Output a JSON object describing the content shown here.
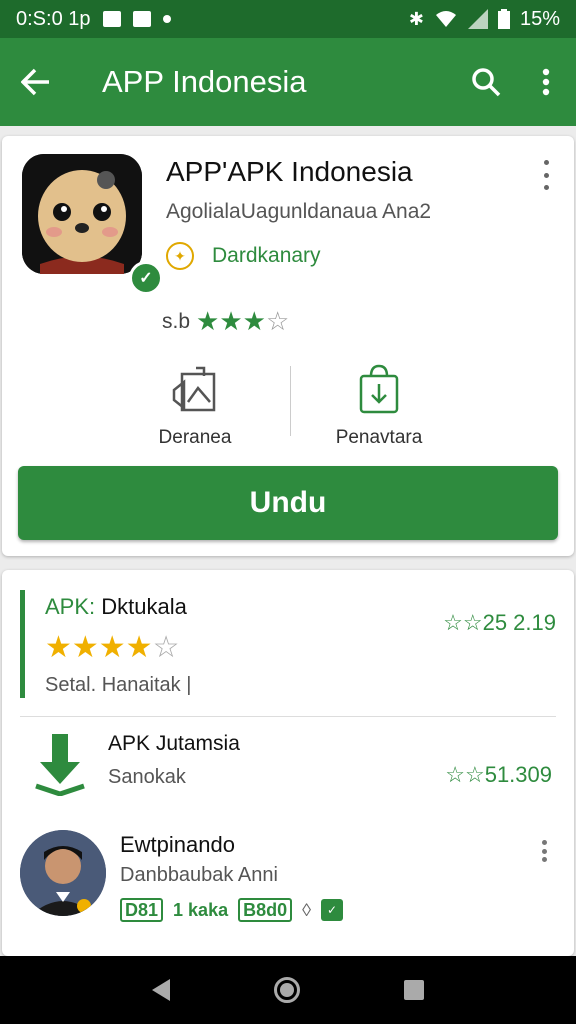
{
  "status_bar": {
    "time": "0:S:0 1p",
    "battery": "15%"
  },
  "app_bar": {
    "title": "APP Indonesia",
    "back_icon": "arrow-back-icon",
    "search_icon": "search-icon",
    "menu_icon": "more-vert-icon"
  },
  "app_card": {
    "name": "APP'APK Indonesia",
    "developer": "AgolialaUagunldanaua Ana2",
    "category": "Dardkanary",
    "rating_prefix": "s.b",
    "rating_stars": 4,
    "rating_max": 5,
    "actions": [
      {
        "label": "Deranea",
        "icon": "share-image-icon"
      },
      {
        "label": "Penavtara",
        "icon": "download-bag-icon"
      }
    ],
    "install_label": "Undu"
  },
  "review": {
    "title_prefix": "APK:",
    "title_rest": " Dktukala",
    "stars": 4,
    "max_stars": 5,
    "subtitle": "Setal. Hanaitak |",
    "count": "☆☆25 2.19"
  },
  "download_item": {
    "title": "APK Jutamsia",
    "subtitle": "Sanokak",
    "count": "☆☆51.309"
  },
  "user_item": {
    "name": "Ewtpinando",
    "subtitle": "Danbbaubak Anni",
    "tag_pill_1": "D81",
    "tag_text": "1 kaka",
    "tag_pill_2": "B8d0"
  },
  "colors": {
    "primary": "#2e8b3e",
    "status_bar": "#1e6b2c",
    "star_gold": "#f0b000"
  }
}
